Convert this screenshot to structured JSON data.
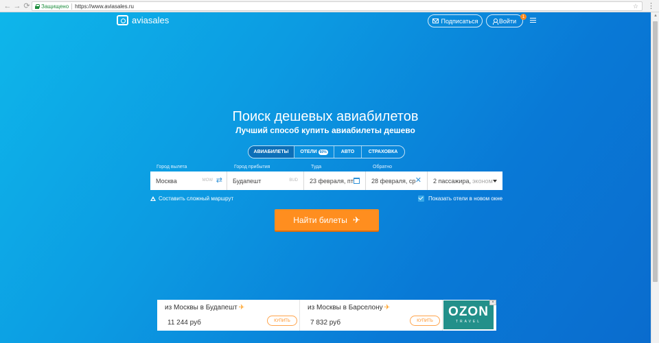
{
  "browser": {
    "back_icon": "arrow-left-icon",
    "forward_icon": "arrow-right-icon",
    "reload_icon": "reload-icon",
    "secure_label": "Защищено",
    "url": "https://www.aviasales.ru"
  },
  "header": {
    "logo_text": "aviasales",
    "subscribe_label": "Подписаться",
    "login_label": "Войти",
    "notification_count": "1"
  },
  "hero": {
    "title": "Поиск дешевых авиабилетов",
    "subtitle": "Лучший способ купить авиабилеты дешево"
  },
  "tabs": [
    {
      "label": "АВИАБИЛЕТЫ",
      "active": true
    },
    {
      "label": "ОТЕЛИ",
      "badge": "60%"
    },
    {
      "label": "АВТО"
    },
    {
      "label": "СТРАХОВКА"
    }
  ],
  "form": {
    "origin": {
      "label": "Город вылета",
      "value": "Москва",
      "code": "MOW"
    },
    "destination": {
      "label": "Город прибытия",
      "value": "Будапешт",
      "code": "BUD"
    },
    "depart": {
      "label": "Туда",
      "value": "23 февраля, пт"
    },
    "return": {
      "label": "Обратно",
      "value": "28 февраля, ср"
    },
    "passengers": {
      "value": "2 пассажира,",
      "class": "эконом"
    },
    "complex_route_label": "Составить сложный маршрут",
    "hotels_new_window_label": "Показать отели в новом окне",
    "hotels_new_window_checked": true,
    "search_button_label": "Найти билеты"
  },
  "deals": [
    {
      "title": "из Москвы в Будапешт",
      "price": "11 244 руб",
      "buy_label": "КУПИТЬ"
    },
    {
      "title": "из Москвы в Барселону",
      "price": "7 832 руб",
      "buy_label": "КУПИТЬ"
    }
  ],
  "ad": {
    "brand": "OZON",
    "brand_sub": "TRAVEL",
    "brand_color": "#23908a"
  },
  "colors": {
    "accent": "#ff8e1f",
    "gradient_start": "#0eb6ea",
    "gradient_end": "#0a6cce",
    "link_blue": "#2a8fd8"
  }
}
